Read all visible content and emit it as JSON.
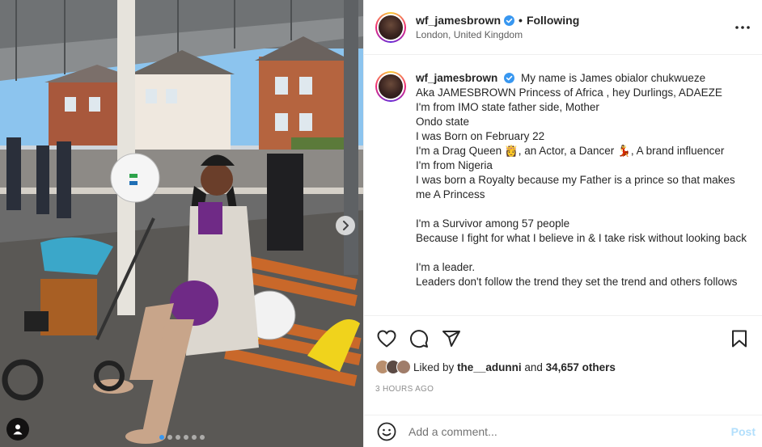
{
  "post": {
    "username": "wf_jamesbrown",
    "follow_status": "Following",
    "separator": "•",
    "location": "London, United Kingdom",
    "caption_lines": [
      "Aka JAMESBROWN Princess of Africa , hey Durlings, ADAEZE",
      "I'm from IMO state father side, Mother",
      "Ondo state",
      "I was Born on February 22",
      "I'm a Drag Queen 👸, an Actor, a Dancer 💃, A brand influencer",
      "I'm from Nigeria",
      "I was born a Royalty because my Father is a prince so that makes me A Princess",
      "",
      "I'm a Survivor among 57 people",
      "Because I fight for what I believe in & I take risk without looking back",
      "",
      "I'm a leader.",
      "Leaders don't follow the trend they set the trend and others follows"
    ],
    "caption_first": "My name is James obialor chukwueze",
    "likes": {
      "prefix": "Liked by",
      "user": "the__adunni",
      "middle": "and",
      "others": "34,657 others"
    },
    "time_ago": "3 HOURS AGO"
  },
  "comment": {
    "placeholder": "Add a comment...",
    "post_label": "Post"
  },
  "carousel": {
    "count": 6,
    "active_index": 0
  },
  "colors": {
    "verified": "#3897f0",
    "post_disabled": "#b2dffc",
    "link_text": "#262626",
    "muted": "#8e8e8e"
  },
  "icons": [
    "more-options-icon",
    "heart-icon",
    "comment-icon",
    "share-icon",
    "bookmark-icon",
    "emoji-icon",
    "user-tag-icon",
    "chevron-right-icon",
    "verified-badge-icon"
  ]
}
